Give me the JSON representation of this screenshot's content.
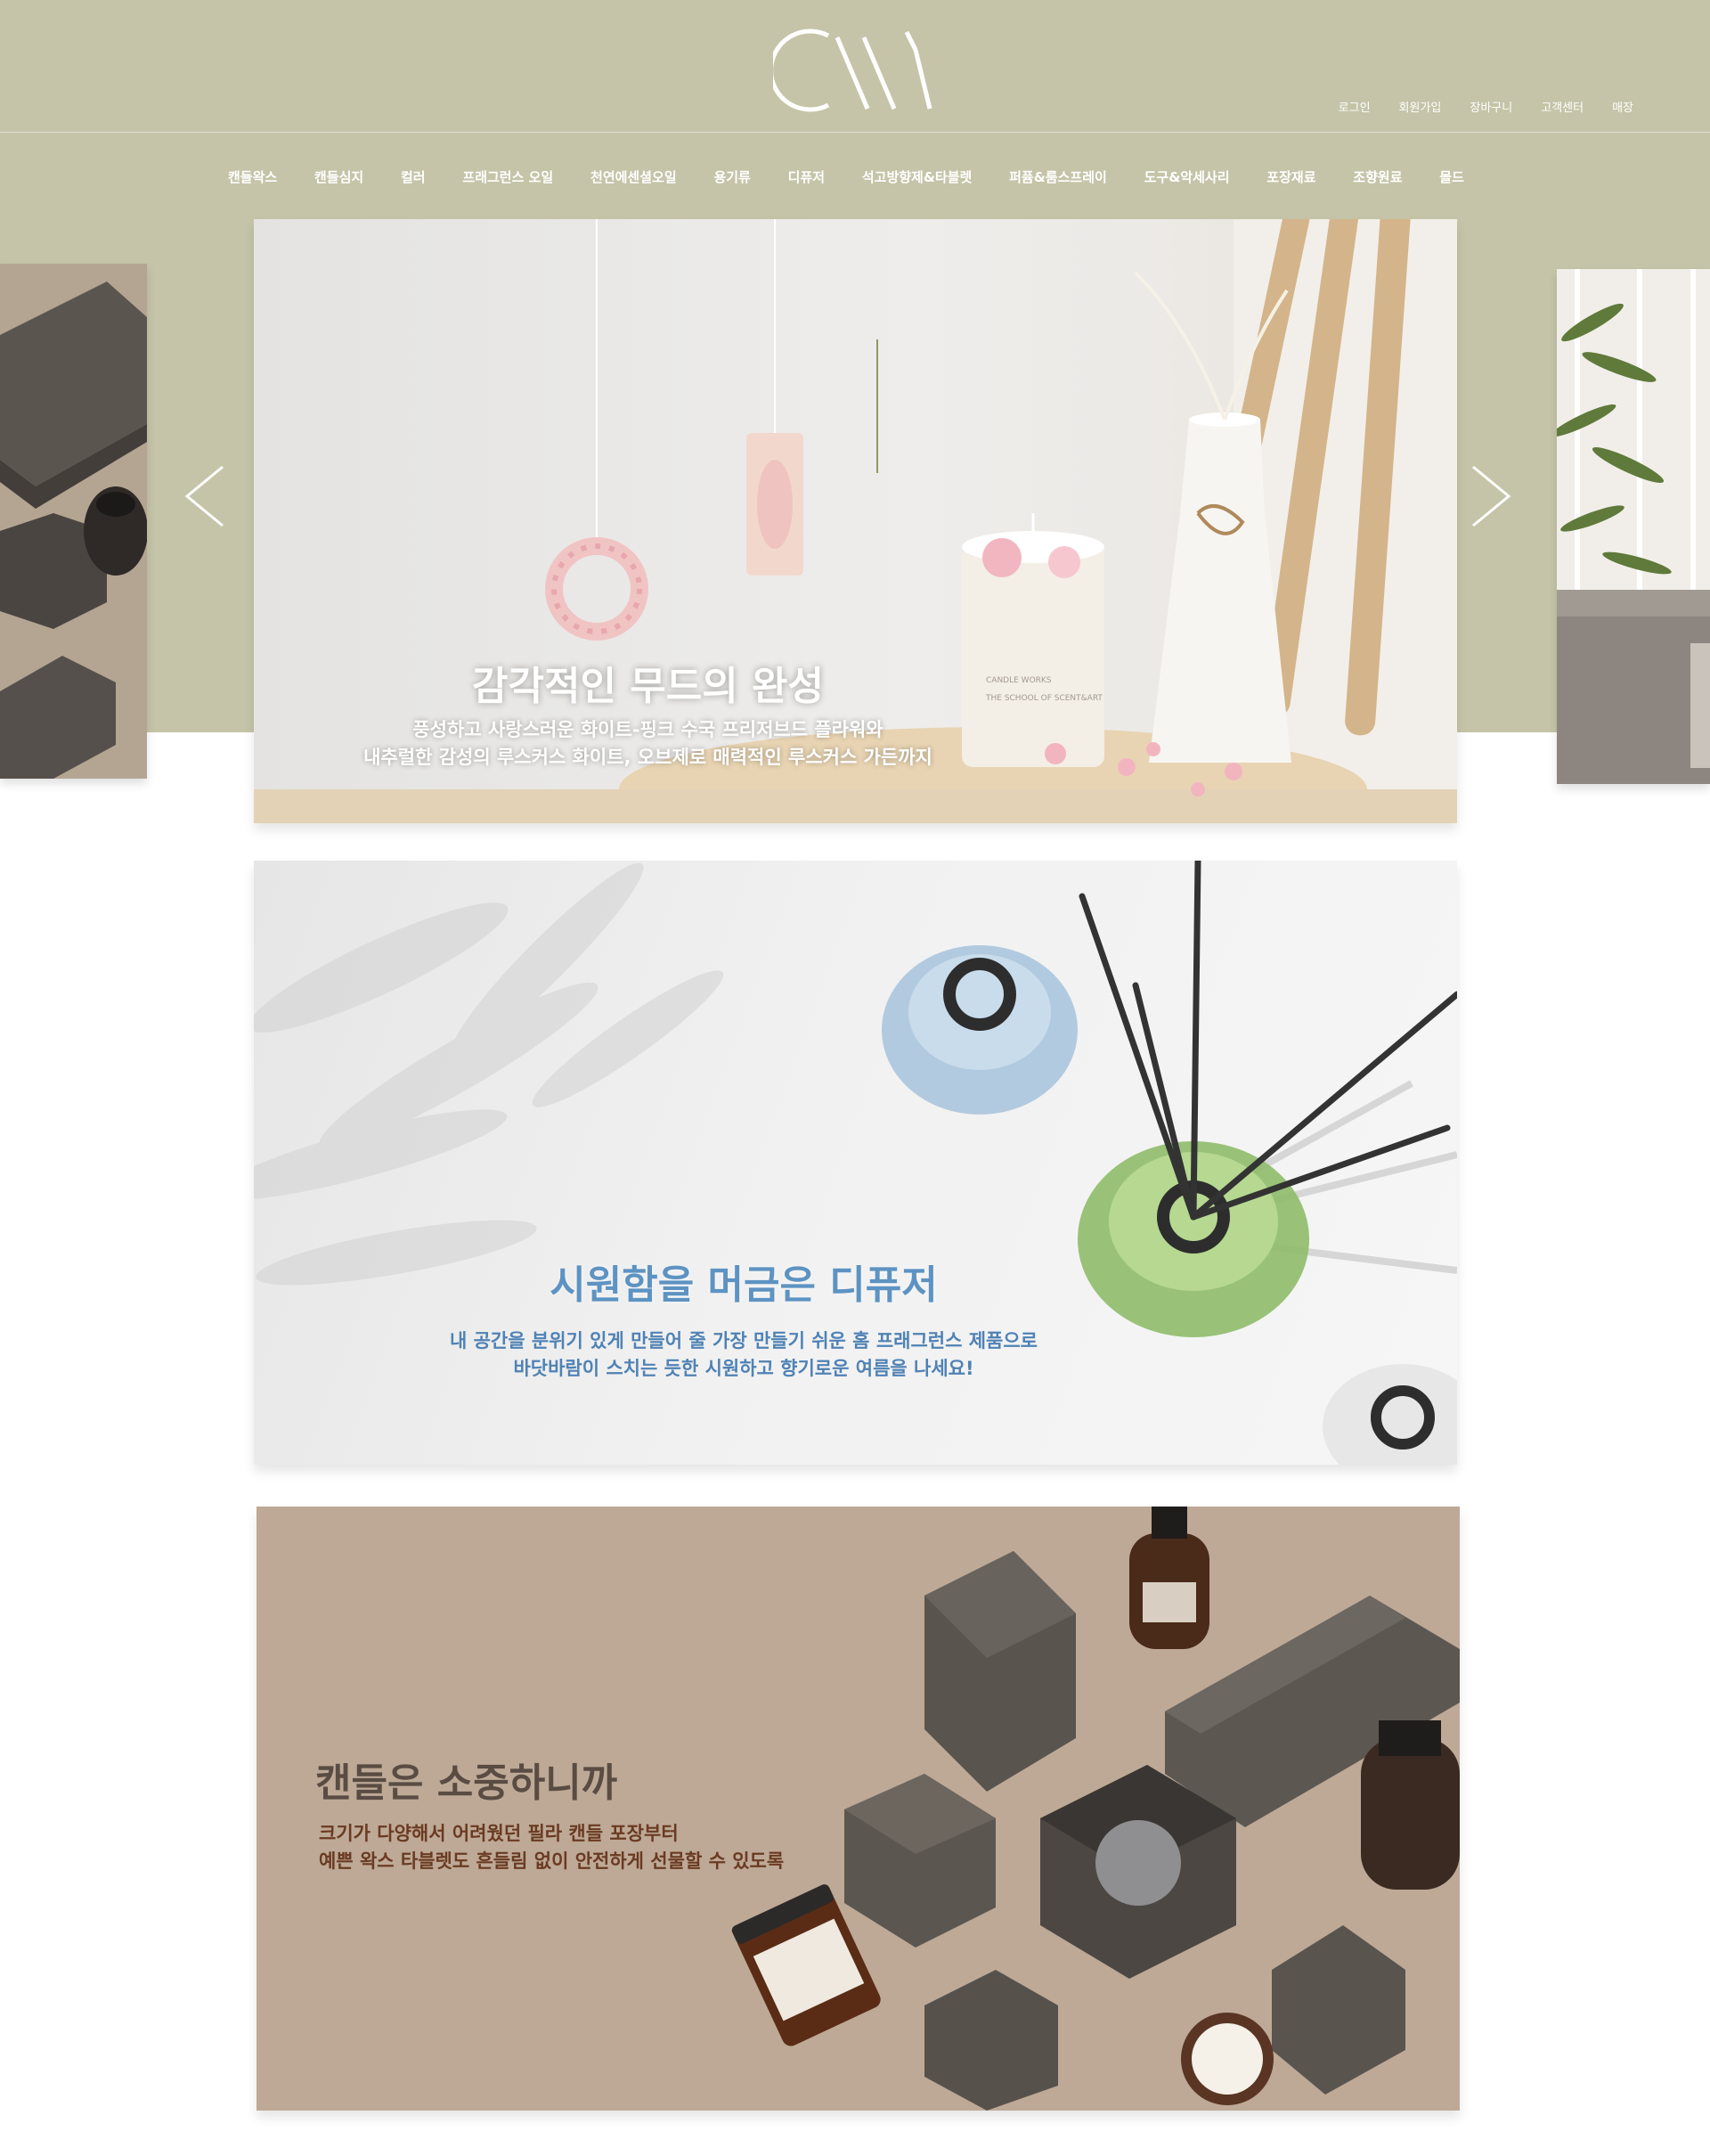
{
  "header": {
    "logo_text": "CW",
    "utility_links": [
      "로그인",
      "회원가입",
      "장바구니",
      "고객센터",
      "매장"
    ]
  },
  "nav": {
    "items": [
      "캔들왁스",
      "캔들심지",
      "컬러",
      "프래그런스 오일",
      "천연에센셜오일",
      "용기류",
      "디퓨저",
      "석고방향제&타블렛",
      "퍼퓸&룸스프레이",
      "도구&악세사리",
      "포장재료",
      "조향원료",
      "몰드"
    ]
  },
  "slider": {
    "prev_icon": "chevron-left-icon",
    "next_icon": "chevron-right-icon"
  },
  "banners": [
    {
      "title": "감각적인 무드의 완성",
      "lines": [
        "풍성하고 사랑스러운 화이트-핑크 수국 프리저브드 플라워와",
        "내추럴한 감성의 루스커스 화이트, 오브제로 매력적인 루스커스 가든까지"
      ],
      "label_text": [
        "CANDLE WORKS",
        "THE SCHOOL OF SCENT&ART"
      ]
    },
    {
      "title": "시원함을 머금은 디퓨저",
      "lines": [
        "내 공간을 분위기 있게 만들어 줄 가장 만들기 쉬운 홈 프래그런스 제품으로",
        "바닷바람이 스치는 듯한 시원하고 향기로운 여름을 나세요!"
      ]
    },
    {
      "title": "캔들은 소중하니까",
      "lines": [
        "크기가 다양해서 어려웠던 필라 캔들 포장부터",
        "예쁜 왁스 타블렛도 흔들림 없이 안전하게 선물할 수 있도록"
      ]
    }
  ],
  "colors": {
    "hero_background": "#c5c4a8",
    "banner2_text": "#5d93c2",
    "banner3_title": "#5a4c43",
    "banner3_text": "#6a3a22"
  }
}
